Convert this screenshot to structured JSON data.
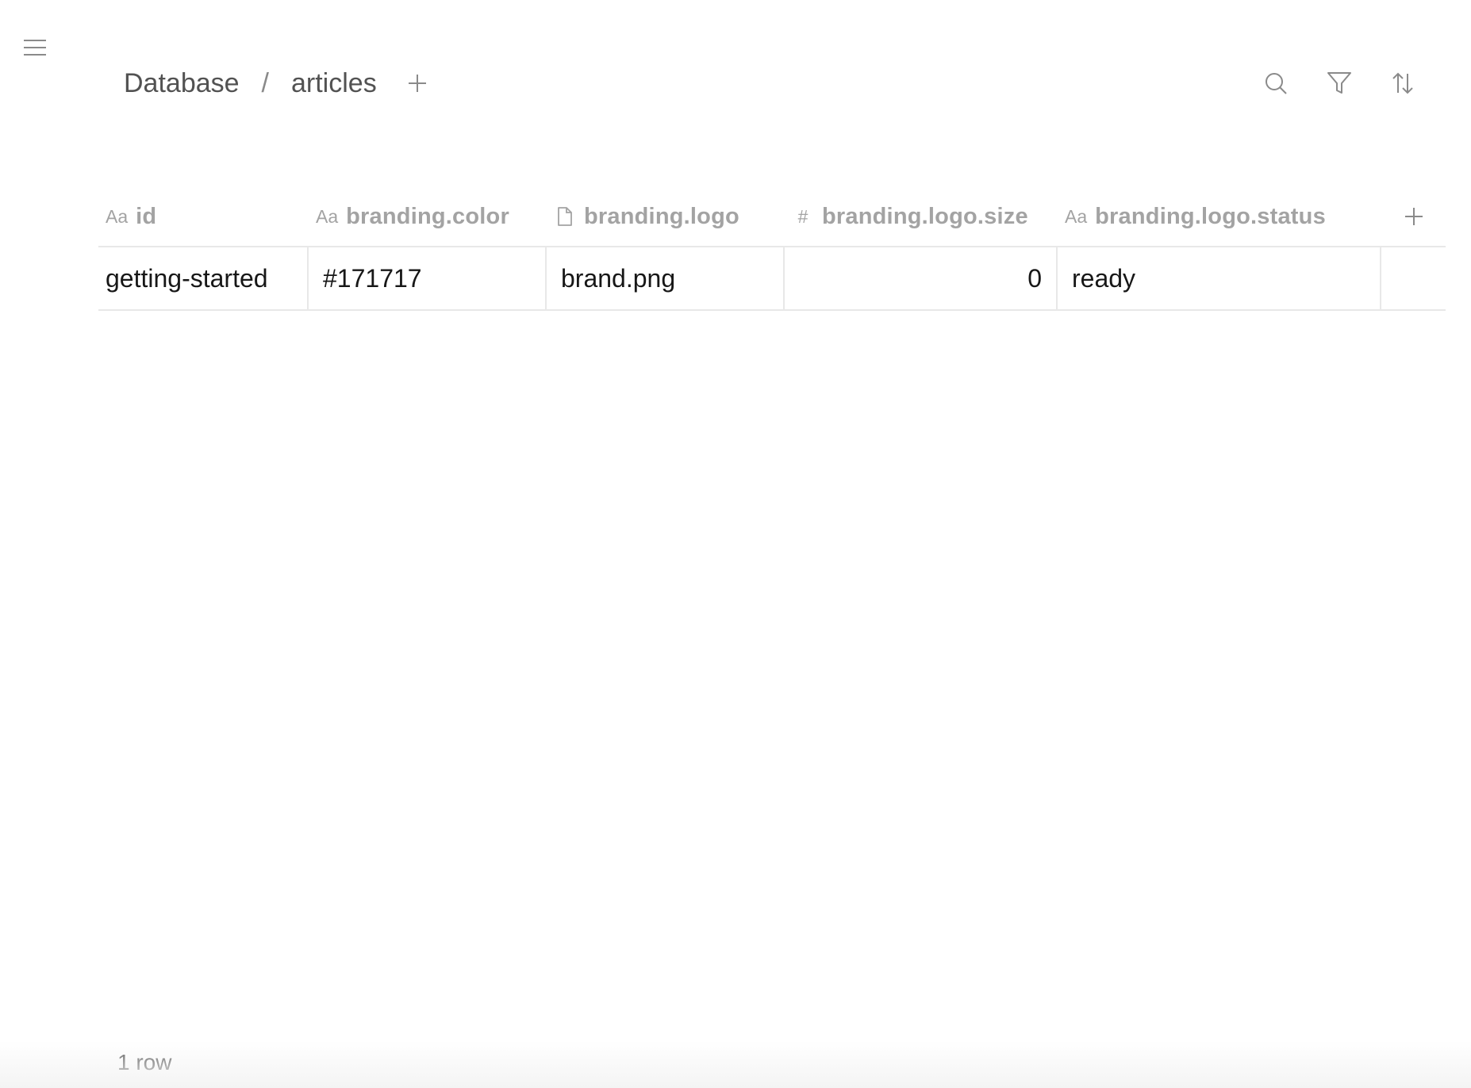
{
  "header": {
    "breadcrumb": [
      "Database",
      "articles"
    ],
    "separator": "/"
  },
  "table": {
    "columns": [
      {
        "type_icon": "Aa",
        "label": "id"
      },
      {
        "type_icon": "Aa",
        "label": "branding.color"
      },
      {
        "type_icon": "file-icon",
        "label": "branding.logo"
      },
      {
        "type_icon": "#",
        "label": "branding.logo.size"
      },
      {
        "type_icon": "Aa",
        "label": "branding.logo.status"
      }
    ],
    "rows": [
      [
        "getting-started",
        "#171717",
        "brand.png",
        "0",
        "ready"
      ]
    ]
  },
  "footer": {
    "row_count": "1 row"
  },
  "colors": {
    "text": "#171717",
    "muted": "#a3a3a3",
    "border": "#e8e8e8"
  }
}
